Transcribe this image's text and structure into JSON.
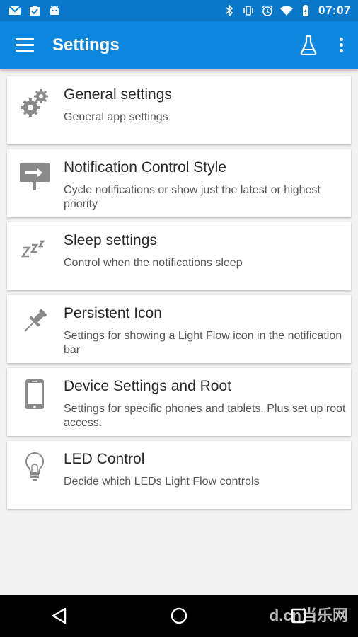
{
  "status_bar": {
    "time": "07:07"
  },
  "app_bar": {
    "title": "Settings"
  },
  "settings": [
    {
      "title": "General settings",
      "subtitle": "General app settings",
      "icon": "gears-icon"
    },
    {
      "title": "Notification Control Style",
      "subtitle": "Cycle notifications or show just the latest or highest priority",
      "icon": "sign-arrow-icon"
    },
    {
      "title": "Sleep settings",
      "subtitle": "Control when the notifications sleep",
      "icon": "sleep-zzz-icon"
    },
    {
      "title": "Persistent Icon",
      "subtitle": "Settings for showing a Light Flow icon in the notification bar",
      "icon": "pin-icon"
    },
    {
      "title": "Device Settings and Root",
      "subtitle": "Settings for specific phones and tablets. Plus set up root access.",
      "icon": "phone-icon"
    },
    {
      "title": "LED Control",
      "subtitle": "Decide which LEDs Light Flow controls",
      "icon": "bulb-icon"
    }
  ],
  "watermark": "d.cn当乐网",
  "colors": {
    "status_bar": "#0a78c8",
    "app_bar": "#0d87dd",
    "background": "#f2f2f2"
  }
}
